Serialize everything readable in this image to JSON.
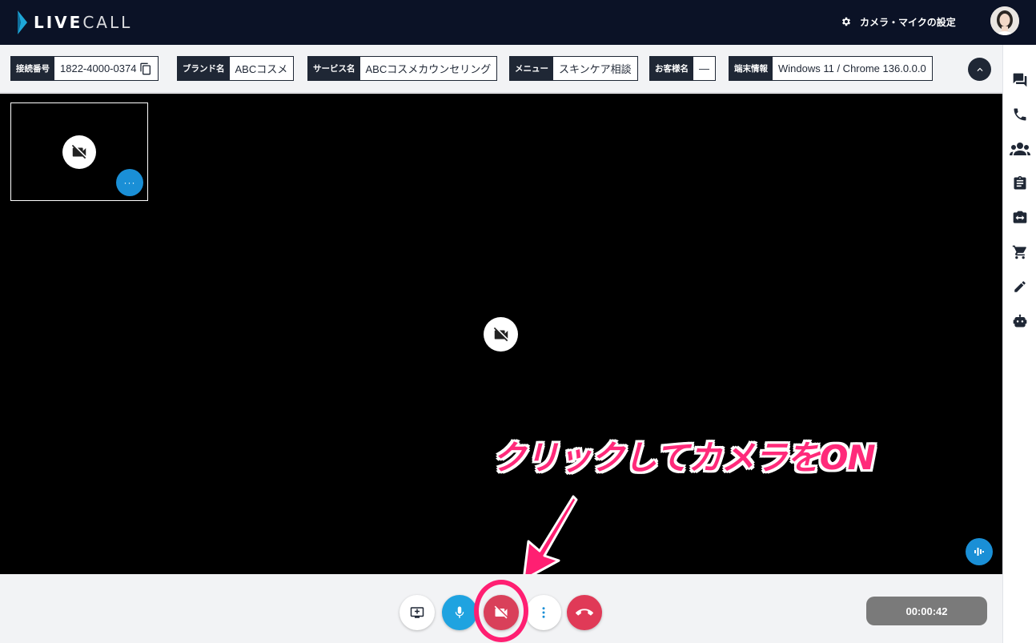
{
  "header": {
    "logo": {
      "prefix": "LIVE",
      "suffix": "CALL"
    },
    "settings_label": "カメラ・マイクの設定"
  },
  "infobar": {
    "fields": [
      {
        "label": "接続番号",
        "value": "1822-4000-0374"
      },
      {
        "label": "ブランド名",
        "value": "ABCコスメ"
      },
      {
        "label": "サービス名",
        "value": "ABCコスメカウンセリング"
      },
      {
        "label": "メニュー",
        "value": "スキンケア相談"
      },
      {
        "label": "お客様名",
        "value": "—"
      },
      {
        "label": "端末情報",
        "value": "Windows 11 / Chrome 136.0.0.0"
      }
    ]
  },
  "rail": {
    "icons": [
      "chat-icon",
      "phone-icon",
      "group-icon",
      "clipboard-icon",
      "camera-switch-icon",
      "cart-icon",
      "pen-icon",
      "robot-icon"
    ]
  },
  "annotation": {
    "text": "クリックしてカメラをON",
    "color": "#ff2a7a"
  },
  "controls": {
    "timer": "00:00:42",
    "pip_more": "···"
  },
  "colors": {
    "header_bg": "#0b1226",
    "label_bg": "#1f2735",
    "accent_blue": "#1a8fd6",
    "danger_red": "#e03a57"
  }
}
